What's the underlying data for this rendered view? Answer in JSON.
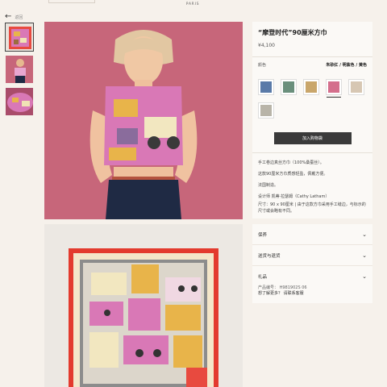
{
  "header": {
    "brand_sub": "PARIS"
  },
  "nav": {
    "back_label": "返回"
  },
  "product": {
    "title": "“摩登时代”90厘米方巾",
    "price": "¥4,100",
    "color_label": "颜色",
    "color_value": "朱砂红 / 明紫色 / 黄色",
    "add_to_cart": "加入购物袋",
    "desc": [
      "手工卷边真丝方巾（100%桑蚕丝）。",
      "这款90厘米方巾质感轻盈，佩戴方便。",
      "法国制造。",
      "设计师 凯蒂·拉瑟姆（Cathy Latham）",
      "尺寸：90 x 90厘米 | 由于这款方巾采用手工缝边，与标示的尺寸或会略有不同。"
    ]
  },
  "accordion": {
    "care": "保养",
    "delivery": "送货与退货",
    "gift": "礼品"
  },
  "details": {
    "ref_label": "产品编号：",
    "ref_value": "H981902S 06",
    "more_label": "想了解更多？",
    "contact": "请联系客服"
  },
  "swatches": [
    {
      "name": "swatch-1",
      "color": "#5a7aa8"
    },
    {
      "name": "swatch-2",
      "color": "#6a8f7c"
    },
    {
      "name": "swatch-3",
      "color": "#c9a66b"
    },
    {
      "name": "swatch-4",
      "color": "#d46f8c"
    },
    {
      "name": "swatch-5",
      "color": "#d7c7b3"
    },
    {
      "name": "swatch-6",
      "color": "#b8b4a8"
    }
  ],
  "colors": {
    "accent": "#3a3a3a",
    "hero_bg": "#c7667a"
  }
}
